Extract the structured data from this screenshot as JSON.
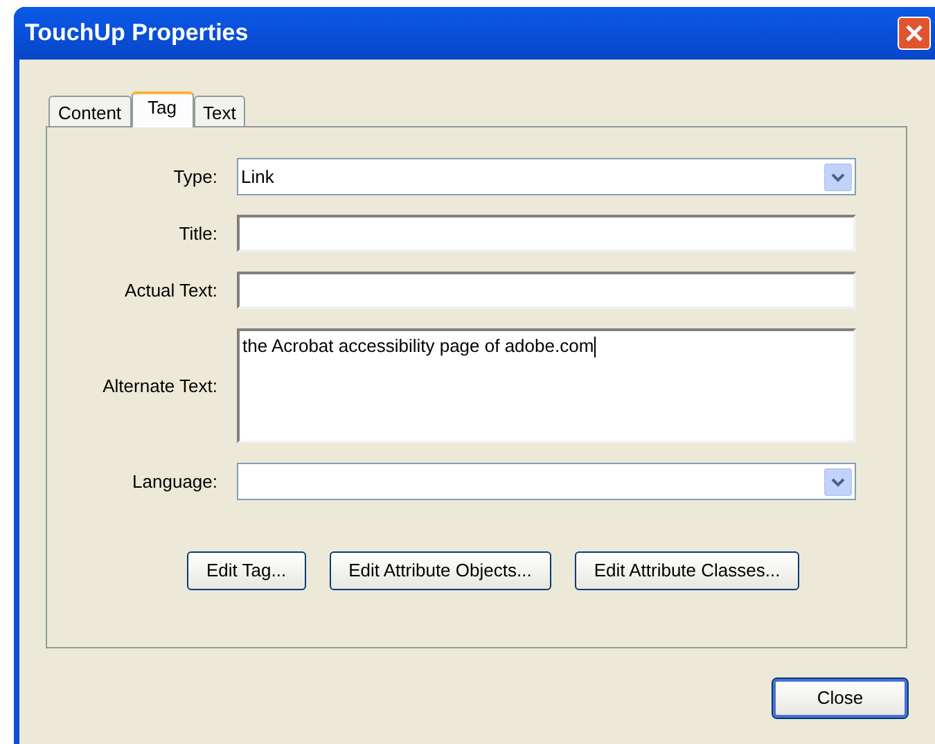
{
  "window": {
    "title": "TouchUp Properties"
  },
  "tabs": [
    {
      "label": "Content",
      "selected": false
    },
    {
      "label": "Tag",
      "selected": true
    },
    {
      "label": "Text",
      "selected": false
    }
  ],
  "fields": [
    {
      "kind": "dropdown",
      "label": "Type:",
      "value": "Link"
    },
    {
      "kind": "text",
      "label": "Title:"
    },
    {
      "kind": "text",
      "label": "Actual Text:"
    },
    {
      "kind": "textarea",
      "label": "Alternate Text:",
      "value": "the Acrobat accessibility page of adobe.com"
    },
    {
      "kind": "dropdown",
      "label": "Language:"
    }
  ],
  "panel_buttons": [
    "Edit Tag...",
    "Edit Attribute Objects...",
    "Edit Attribute Classes..."
  ],
  "footer_buttons": [
    "Close"
  ]
}
